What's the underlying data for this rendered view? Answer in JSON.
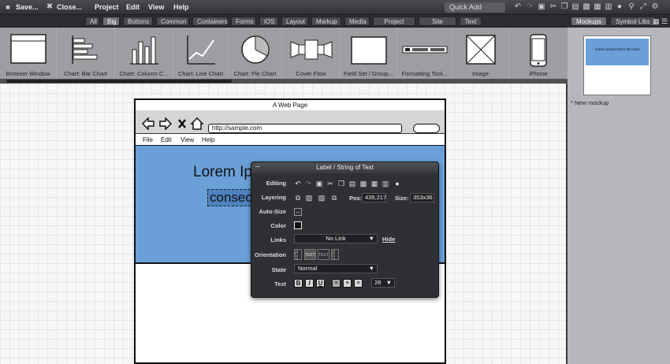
{
  "menubar": {
    "save": "Save...",
    "close": "Close...",
    "items": [
      "Project",
      "Edit",
      "View",
      "Help"
    ],
    "quick_add": "Quick Add"
  },
  "categories": [
    "All",
    "Big",
    "Buttons",
    "Common",
    "Containers",
    "Forms",
    "iOS",
    "Layout",
    "Markup",
    "Media",
    "Project Assets",
    "Site Assets",
    "Text"
  ],
  "active_category": "Big",
  "library": [
    "Browser Window",
    "Chart: Bar Chart",
    "Chart: Column C...",
    "Chart: Line Chart",
    "Chart: Pie Chart",
    "Cover Flow",
    "Field Set / Group...",
    "Formatting Tool...",
    "Image",
    "iPhone"
  ],
  "right_panel": {
    "tabs": [
      "Mockups",
      "Symbol Libs"
    ],
    "new_mockup": "* New mockup",
    "thumb_text": "Lorem Ipsum Dolor Sit Amet"
  },
  "mockup": {
    "title": "A Web Page",
    "url": "http://sample.com",
    "menu": [
      "File",
      "Edit",
      "View",
      "Help"
    ],
    "line1": "Lorem Ip",
    "line2": "consec"
  },
  "inspector": {
    "title": "Label / String of Text",
    "labels": {
      "editing": "Editing",
      "layering": "Layering",
      "autosize": "Auto-Size",
      "color": "Color",
      "links": "Links",
      "orientation": "Orientation",
      "state": "State",
      "text": "Text"
    },
    "pos_label": "Pos:",
    "pos_value": "439,217",
    "size_label": "Size:",
    "size_value": "353x36",
    "link_value": "No Link",
    "hide": "Hide",
    "state_value": "Normal",
    "font_size": "28",
    "orient": [
      "TEXT",
      "TEXT",
      "TEXT",
      "TEXT"
    ]
  }
}
